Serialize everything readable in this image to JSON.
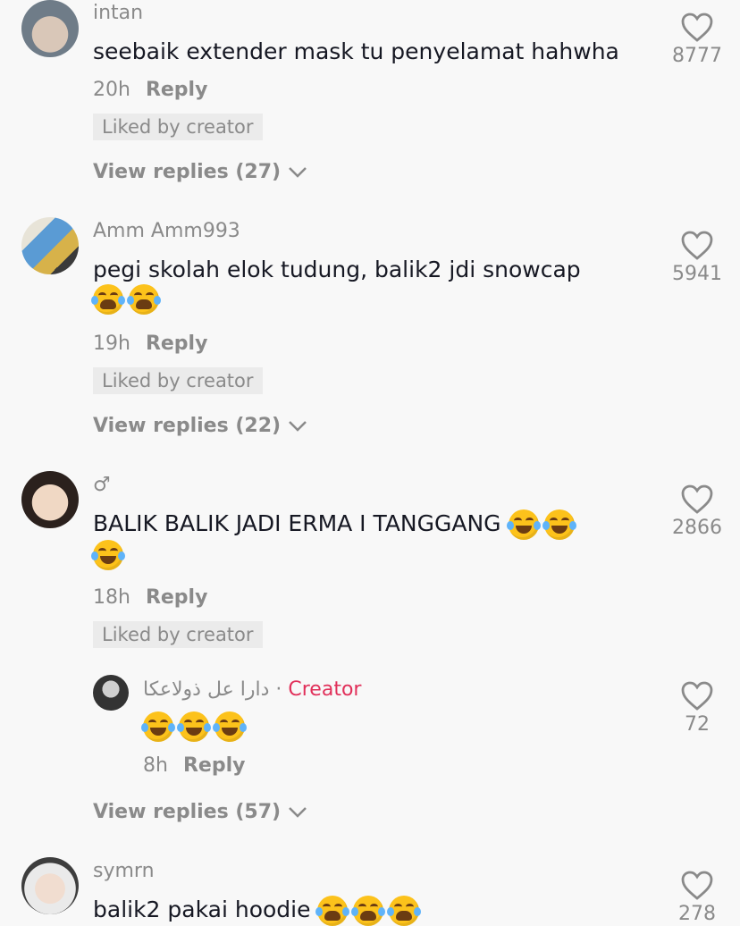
{
  "comments": [
    {
      "username": "intan",
      "text": "seebaik extender mask tu penyelamat hahwha",
      "time": "20h",
      "reply_label": "Reply",
      "liked_label": "Liked by creator",
      "view_replies": "View replies (27)",
      "likes": "8777"
    },
    {
      "username": "Amm Amm993",
      "text": "pegi skolah elok tudung, balik2 jdi snowcap",
      "time": "19h",
      "reply_label": "Reply",
      "liked_label": "Liked by creator",
      "view_replies": "View replies (22)",
      "likes": "5941"
    },
    {
      "username": "♂",
      "text": "BALIK BALIK JADI ERMA I TANGGANG",
      "time": "18h",
      "reply_label": "Reply",
      "liked_label": "Liked by creator",
      "view_replies": "View replies (57)",
      "likes": "2866",
      "reply": {
        "username": "دارا عل ذولاعكا",
        "separator": "·",
        "badge": "Creator",
        "time": "8h",
        "reply_label": "Reply",
        "likes": "72"
      }
    },
    {
      "username": "symrn",
      "text": "balik2 pakai hoodie",
      "likes": "278"
    }
  ],
  "colors": {
    "accent": "#e1305a",
    "muted": "#8a8a8a",
    "text": "#161823",
    "background": "#f8f8f8"
  },
  "icons": {
    "like": "heart-outline-icon",
    "expand": "chevron-down-icon",
    "emoji_cry": "loudly-crying-face",
    "emoji_laugh": "face-with-tears-of-joy"
  }
}
